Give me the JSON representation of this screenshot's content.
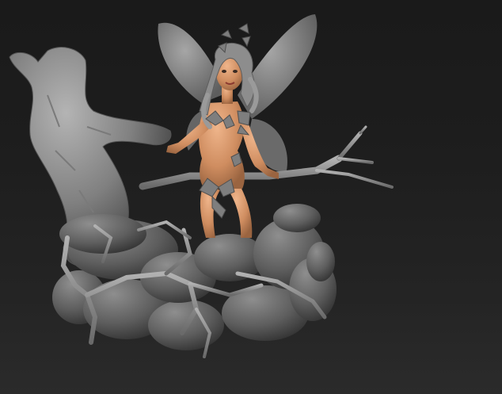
{
  "viewport": {
    "object": "fairy-on-rocks-sculpt",
    "background_top": "#1a1a1a",
    "background_bottom": "#2b2b2b",
    "clay_color": "#8a8a8a",
    "skin_color": "#d49468",
    "hair_color": "#8d8d8d",
    "wing_color": "#8a8a8a"
  }
}
